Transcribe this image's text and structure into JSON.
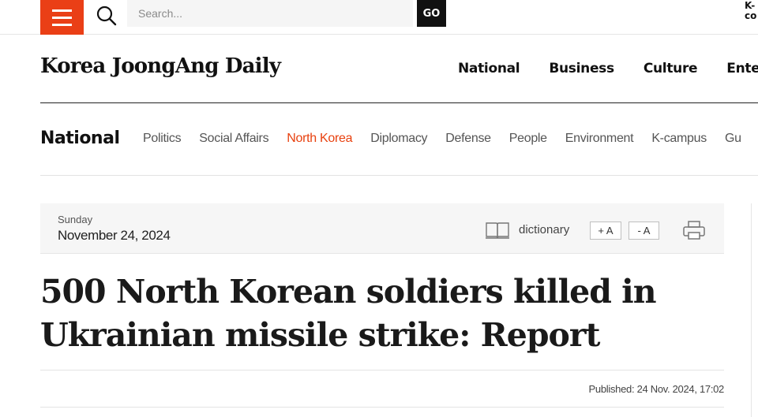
{
  "search": {
    "placeholder": "Search...",
    "go_label": "GO"
  },
  "corner_logo": "K-\nco",
  "brand": "Korea JoongAng Daily",
  "main_nav": [
    "National",
    "Business",
    "Culture",
    "Entert"
  ],
  "section": {
    "title": "National",
    "items": [
      "Politics",
      "Social Affairs",
      "North Korea",
      "Diplomacy",
      "Defense",
      "People",
      "Environment",
      "K-campus",
      "Gu"
    ],
    "active": "North Korea"
  },
  "datebar": {
    "day": "Sunday",
    "date": "November 24, 2024",
    "dictionary_label": "dictionary",
    "font_up_label": "+ A",
    "font_down_label": "- A"
  },
  "article": {
    "headline_line1": "500 North Korean soldiers killed in",
    "headline_line2": "Ukrainian missile strike: Report",
    "published": "Published: 24 Nov. 2024, 17:02"
  },
  "colors": {
    "accent": "#ea3f16",
    "active_link": "#e8410f"
  },
  "icons": [
    "hamburger-menu-icon",
    "search-icon",
    "book-icon",
    "print-icon"
  ]
}
